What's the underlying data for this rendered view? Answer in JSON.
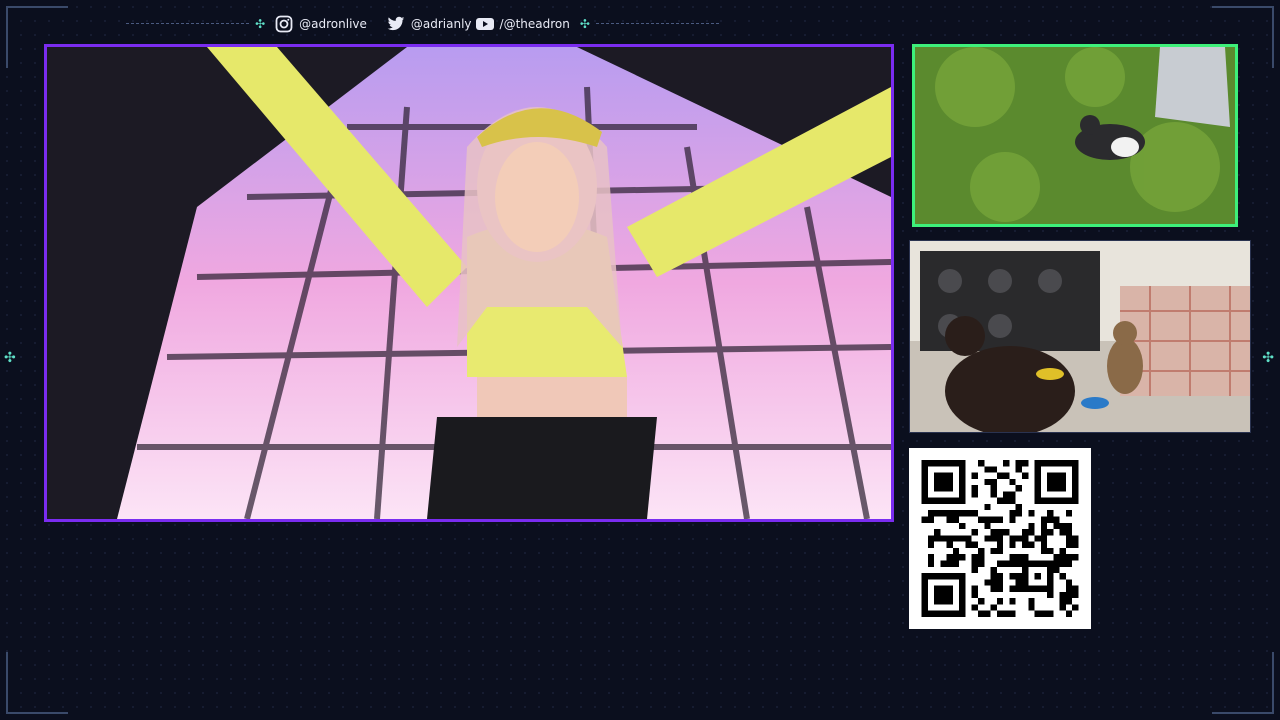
{
  "header": {
    "instagram": {
      "icon": "instagram-icon",
      "handle": "@adronlive"
    },
    "twitter": {
      "icon": "twitter-icon",
      "handle": "@adrianly"
    },
    "youtube": {
      "icon": "youtube-icon",
      "handle": "/@theadron"
    }
  },
  "panels": {
    "main_video": "dance-floor-video",
    "cam_top": "grass-cat-camera",
    "cam_bottom": "indoor-cats-camera",
    "qr": "qr-code"
  },
  "colors": {
    "background": "#0b0f1e",
    "main_border": "#7a2cf0",
    "cam_border": "#3ef07a",
    "accent": "#5fe0c8"
  }
}
